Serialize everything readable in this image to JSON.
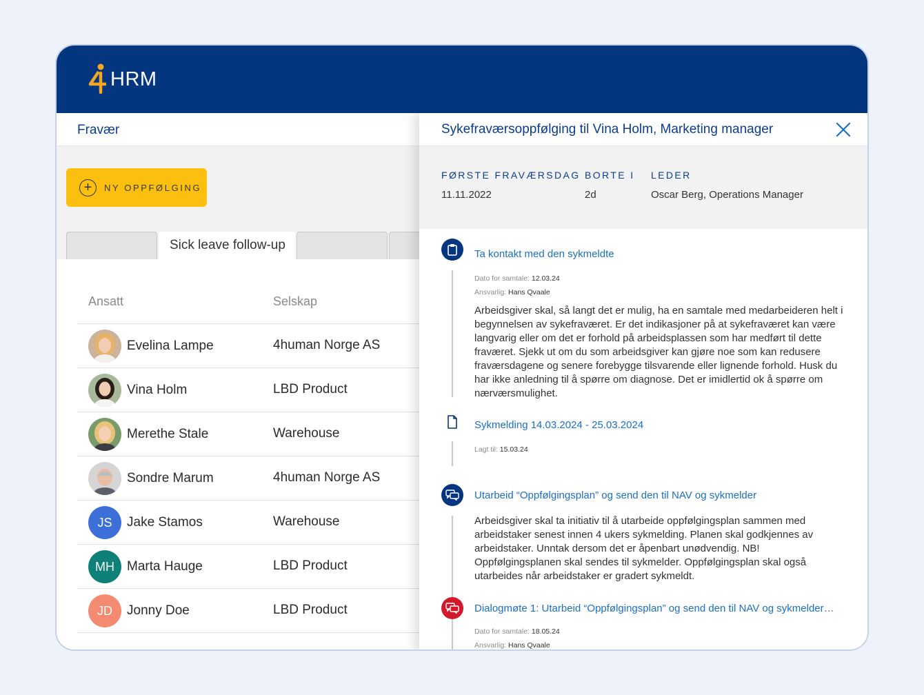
{
  "app": {
    "logo_text": "HRM",
    "logo_mark": "4"
  },
  "left": {
    "header": "Fravær",
    "new_button": "NY OPPFØLGING",
    "tabs": [
      "",
      "Sick leave follow-up",
      "",
      ""
    ],
    "columns": {
      "employee": "Ansatt",
      "company": "Selskap"
    },
    "rows": [
      {
        "name": "Evelina Lampe",
        "company": "4human Norge AS",
        "avatar": "photo"
      },
      {
        "name": "Vina Holm",
        "company": "LBD Product",
        "avatar": "photo"
      },
      {
        "name": "Merethe Stale",
        "company": "Warehouse",
        "avatar": "photo"
      },
      {
        "name": "Sondre Marum",
        "company": "4human Norge AS",
        "avatar": "photo"
      },
      {
        "name": "Jake Stamos",
        "company": "Warehouse",
        "initials": "JS",
        "color": "#3d6fd9"
      },
      {
        "name": "Marta Hauge",
        "company": "LBD Product",
        "initials": "MH",
        "color": "#0d8077"
      },
      {
        "name": "Jonny Doe",
        "company": "LBD Product",
        "initials": "JD",
        "color": "#f48a6f"
      }
    ]
  },
  "panel": {
    "title": "Sykefraværsoppfølging til Vina Holm, Marketing manager",
    "info": {
      "first_day_label": "FØRSTE FRAVÆRSDAG",
      "first_day_value": "11.11.2022",
      "away_label": "BORTE I",
      "away_value": "2d",
      "leader_label": "LEDER",
      "leader_value": "Oscar Berg, Operations Manager"
    },
    "items": [
      {
        "title": "Ta kontakt med den sykmeldte",
        "icon": "clipboard-icon",
        "date_label": "Dato for samtale:",
        "date_value": "12.03.24",
        "resp_label": "Ansvarlig:",
        "resp_value": "Hans Qvaale",
        "text": "Arbeidsgiver skal, så langt det er mulig, ha en samtale med medarbeideren helt i begynnelsen av sykefraværet. Er det indikasjoner på at sykefraværet kan være langvarig eller om det er forhold på arbeidsplassen som har medført til dette fraværet. Sjekk ut om du som arbeidsgiver kan gjøre noe som kan redusere fraværsdagene og senere forebygge tilsvarende eller lignende forhold. Husk du har ikke anledning til å spørre om diagnose. Det er imidlertid ok å spørre om nærværsmulighet."
      },
      {
        "title": "Sykmelding 14.03.2024 - 25.03.2024",
        "icon": "document-icon",
        "added_label": "Lagt til:",
        "added_value": "15.03.24"
      },
      {
        "title": "Utarbeid “Oppfølgingsplan” og send den til NAV og sykmelder",
        "icon": "chat-icon",
        "text": "Arbeidsgiver skal ta initiativ til å utarbeide oppfølgingsplan sammen med arbeidstaker senest innen 4 ukers sykmelding. Planen skal godkjennes av arbeidstaker. Unntak dersom det er åpenbart unødvendig. NB! Oppfølgingsplanen skal sendes til sykmelder. Oppfølgingsplan skal også utarbeides når arbeidstaker er gradert sykmeldt."
      },
      {
        "title": "Dialogmøte 1: Utarbeid “Oppfølgingsplan” og send den til NAV og sykmelder…",
        "icon": "chat-icon",
        "color": "#d0192b",
        "date_label": "Dato for samtale:",
        "date_value": "18.05.24",
        "resp_label": "Ansvarlig:",
        "resp_value": "Hans Qvaale"
      }
    ]
  },
  "colors": {
    "brand": "#04357f",
    "accent": "#fbbf0f",
    "link": "#1a6fc6",
    "alert": "#d0192b"
  }
}
